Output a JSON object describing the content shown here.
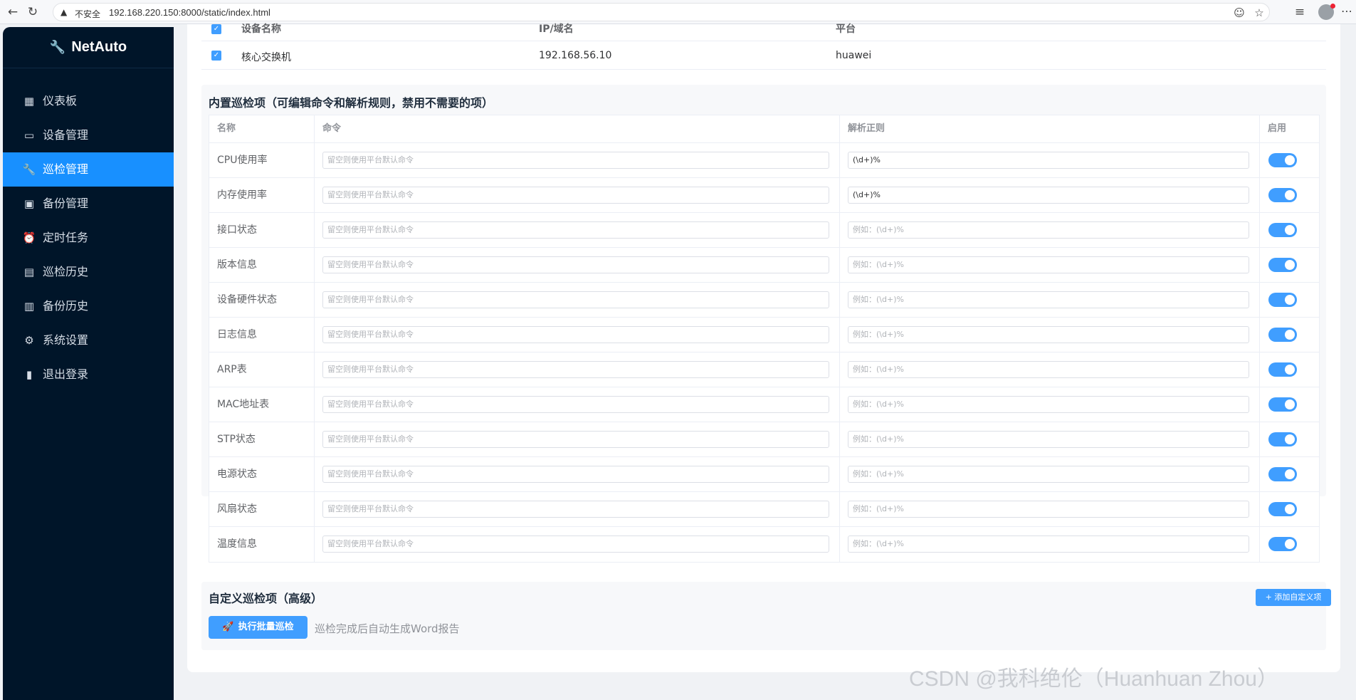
{
  "browser": {
    "insecure_label": "不安全",
    "url": "192.168.220.150:8000/static/index.html"
  },
  "app": {
    "logo_text": "NetAuto"
  },
  "sidebar": {
    "items": [
      {
        "label": "仪表板",
        "icon": "dashboard-icon",
        "glyph": "▦"
      },
      {
        "label": "设备管理",
        "icon": "device-icon",
        "glyph": "▭"
      },
      {
        "label": "巡检管理",
        "icon": "wrench-icon",
        "glyph": "🔧",
        "active": true
      },
      {
        "label": "备份管理",
        "icon": "floppy-icon",
        "glyph": "▣"
      },
      {
        "label": "定时任务",
        "icon": "alarm-clock-icon",
        "glyph": "⏰"
      },
      {
        "label": "巡检历史",
        "icon": "notepad-icon",
        "glyph": "▤"
      },
      {
        "label": "备份历史",
        "icon": "page-icon",
        "glyph": "▥"
      },
      {
        "label": "系统设置",
        "icon": "gear-icon",
        "glyph": "⚙"
      },
      {
        "label": "退出登录",
        "icon": "door-icon",
        "glyph": "▮"
      }
    ]
  },
  "devices": {
    "headers": [
      "设备名称",
      "IP/域名",
      "平台"
    ],
    "rows": [
      {
        "name": "核心交换机",
        "ip": "192.168.56.10",
        "platform": "huawei",
        "checked": true
      }
    ]
  },
  "builtin": {
    "title": "内置巡检项（可编辑命令和解析规则，禁用不需要的项）",
    "headers": {
      "name": "名称",
      "command": "命令",
      "regex": "解析正则",
      "enabled": "启用"
    },
    "command_placeholder": "留空则使用平台默认命令",
    "regex_placeholder": "例如：(\\d+)%",
    "items": [
      {
        "name": "CPU使用率",
        "regex": "(\\d+)%",
        "enabled": true
      },
      {
        "name": "内存使用率",
        "regex": "(\\d+)%",
        "enabled": true
      },
      {
        "name": "接口状态",
        "regex": "",
        "enabled": true
      },
      {
        "name": "版本信息",
        "regex": "",
        "enabled": true
      },
      {
        "name": "设备硬件状态",
        "regex": "",
        "enabled": true
      },
      {
        "name": "日志信息",
        "regex": "",
        "enabled": true
      },
      {
        "name": "ARP表",
        "regex": "",
        "enabled": true
      },
      {
        "name": "MAC地址表",
        "regex": "",
        "enabled": true
      },
      {
        "name": "STP状态",
        "regex": "",
        "enabled": true
      },
      {
        "name": "电源状态",
        "regex": "",
        "enabled": true
      },
      {
        "name": "风扇状态",
        "regex": "",
        "enabled": true
      },
      {
        "name": "温度信息",
        "regex": "",
        "enabled": true
      }
    ]
  },
  "custom": {
    "title": "自定义巡检项（高级）",
    "add_label": "+ 添加自定义项",
    "run_label": "执行批量巡检",
    "hint": "巡检完成后自动生成Word报告"
  },
  "watermark": "CSDN @我科绝伦（Huanhuan Zhou）",
  "colors": {
    "primary": "#409eff",
    "sidebar": "#001529",
    "active": "#1890ff"
  }
}
